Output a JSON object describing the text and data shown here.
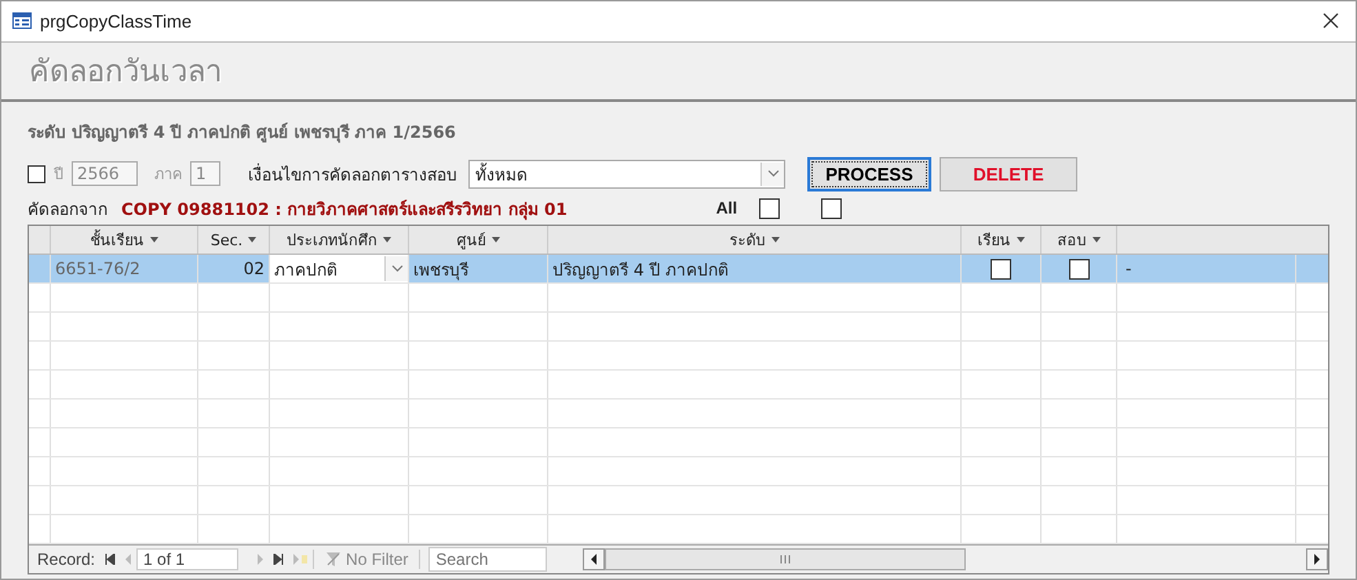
{
  "window": {
    "title": "prgCopyClassTime"
  },
  "header": {
    "title": "คัดลอกวันเวลา"
  },
  "info": "ระดับ ปริญญาตรี 4 ปี ภาคปกติ ศูนย์ เพชรบุรี ภาค 1/2566",
  "filter": {
    "year_checkbox": {
      "checked": false
    },
    "year_label": "ปี",
    "year": "2566",
    "term_label": "ภาค",
    "term": "1",
    "disabled": true,
    "condition_label": "เงื่อนไขการคัดลอกตารางสอบ",
    "condition": "ทั้งหมด"
  },
  "buttons": [
    {
      "label": "PROCESS",
      "kind": "primary"
    },
    {
      "label": "DELETE",
      "kind": "danger"
    }
  ],
  "copy_from": {
    "label": "คัดลอกจาก",
    "value": "COPY 09881102 : กายวิภาคศาสตร์และสรีรวิทยา กลุ่ม 01"
  },
  "all": {
    "label": "All",
    "checkboxes": [
      {
        "checked": false
      },
      {
        "checked": false
      }
    ]
  },
  "table": {
    "columns": [
      "ชั้นเรียน",
      "Sec.",
      "ประเภทนักศึก",
      "ศูนย์",
      "ระดับ",
      "เรียน",
      "สอบ"
    ],
    "rows": [
      {
        "selected": true,
        "class": "6651-76/2",
        "sec": "02",
        "type": "ภาคปกติ",
        "center": "เพชรบุรี",
        "level": "ปริญญาตรี 4 ปี ภาคปกติ",
        "study": false,
        "exam": false,
        "extra": "-"
      }
    ]
  },
  "record_bar": {
    "label": "Record:",
    "position": "1 of 1",
    "filter": "No Filter",
    "search_field": {
      "placeholder": "Search"
    }
  }
}
